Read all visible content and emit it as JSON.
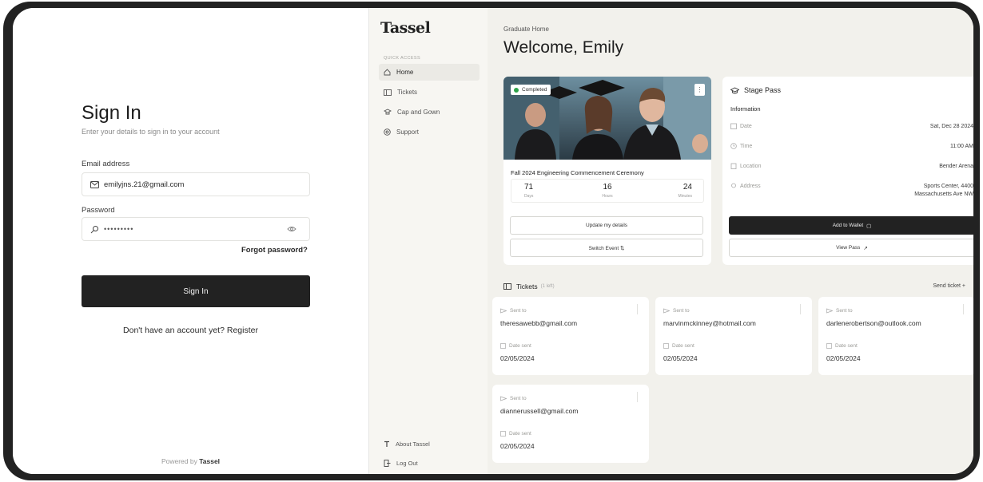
{
  "signin": {
    "title": "Sign In",
    "subtitle": "Enter your details to sign in to your account",
    "email_label": "Email address",
    "email_value": "emilyjns.21@gmail.com",
    "password_label": "Password",
    "password_value": "•••••••••",
    "forgot": "Forgot password?",
    "button": "Sign In",
    "register": "Don't have an account yet? Register",
    "powered_prefix": "Powered by",
    "powered_brand": "Tassel"
  },
  "sidebar": {
    "logo": "Tassel",
    "section": "QUICK ACCESS",
    "items": [
      {
        "label": "Home",
        "icon": "home-icon",
        "active": true
      },
      {
        "label": "Tickets",
        "icon": "ticket-icon"
      },
      {
        "label": "Cap and Gown",
        "icon": "gown-icon"
      },
      {
        "label": "Support",
        "icon": "support-icon"
      }
    ],
    "about": "About Tassel",
    "logout": "Log Out"
  },
  "main": {
    "breadcrumb": "Graduate Home",
    "welcome": "Welcome, Emily",
    "event": {
      "badge": "Completed",
      "title": "Fall 2024 Engineering Commencement Ceremony",
      "countdown": [
        {
          "value": "71",
          "label": "Days"
        },
        {
          "value": "16",
          "label": "Hours"
        },
        {
          "value": "24",
          "label": "Minutes"
        }
      ],
      "update_btn": "Update my details",
      "switch_btn": "Switch Event ⇅"
    },
    "stage_pass": {
      "title": "Stage Pass",
      "info_head": "Information",
      "rows": [
        {
          "key": "Date",
          "value": "Sat, Dec 28 2024"
        },
        {
          "key": "Time",
          "value": "11:00 AM"
        },
        {
          "key": "Location",
          "value": "Bender Arena"
        },
        {
          "key": "Address",
          "value": "Sports Center, 4400 Massachusetts Ave NW"
        }
      ],
      "wallet_btn": "Add to Wallet",
      "view_btn": "View Pass"
    },
    "tickets": {
      "title": "Tickets",
      "count": "(1 left)",
      "send": "Send ticket +",
      "sent_to_label": "Sent to",
      "date_label": "Date sent",
      "items": [
        {
          "email": "theresawebb@gmail.com",
          "date": "02/05/2024"
        },
        {
          "email": "marvinmckinney@hotmail.com",
          "date": "02/05/2024"
        },
        {
          "email": "darlenerobertson@outlook.com",
          "date": "02/05/2024"
        },
        {
          "email": "diannerussell@gmail.com",
          "date": "02/05/2024"
        }
      ]
    }
  },
  "colors": {
    "dark": "#222222",
    "sidebar_bg": "#f7f6f2",
    "main_bg": "#f2f1ec",
    "success": "#2fa34a"
  }
}
